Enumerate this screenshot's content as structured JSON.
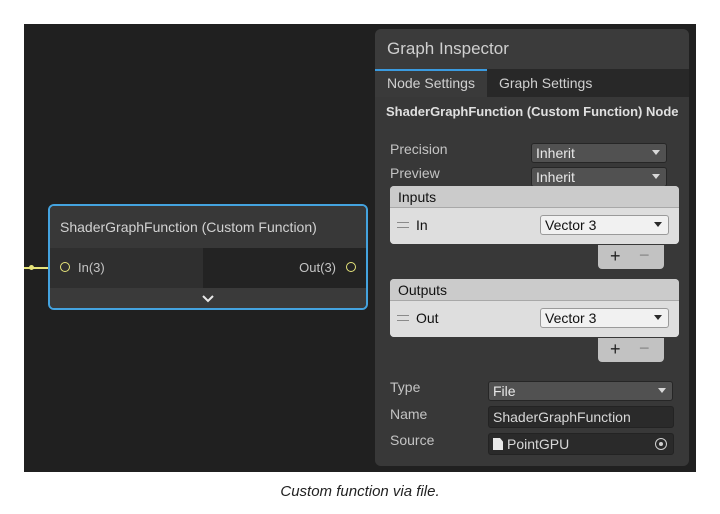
{
  "graph": {
    "node": {
      "title": "ShaderGraphFunction (Custom Function)",
      "input_port": "In(3)",
      "output_port": "Out(3)"
    }
  },
  "inspector": {
    "title": "Graph Inspector",
    "tabs": [
      {
        "label": "Node Settings",
        "active": true
      },
      {
        "label": "Graph Settings",
        "active": false
      }
    ],
    "node_name": "ShaderGraphFunction (Custom Function) Node",
    "precision": {
      "label": "Precision",
      "value": "Inherit"
    },
    "preview": {
      "label": "Preview",
      "value": "Inherit"
    },
    "inputs": {
      "header": "Inputs",
      "items": [
        {
          "name": "In",
          "type": "Vector 3"
        }
      ],
      "add": "+",
      "remove": "−"
    },
    "outputs": {
      "header": "Outputs",
      "items": [
        {
          "name": "Out",
          "type": "Vector 3"
        }
      ],
      "add": "+",
      "remove": "−"
    },
    "type": {
      "label": "Type",
      "value": "File"
    },
    "name": {
      "label": "Name",
      "value": "ShaderGraphFunction"
    },
    "source": {
      "label": "Source",
      "value": "PointGPU"
    }
  },
  "caption": "Custom function via file.",
  "colors": {
    "accent": "#44a3df",
    "port": "#e6e47a",
    "background": "#202020"
  }
}
